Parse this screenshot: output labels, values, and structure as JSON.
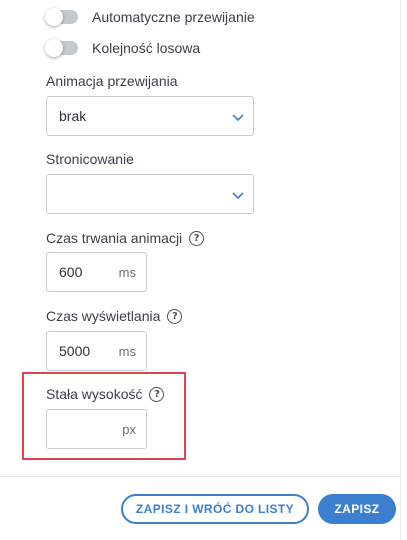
{
  "toggles": [
    {
      "label": "Automatyczne przewijanie",
      "on": false
    },
    {
      "label": "Kolejność losowa",
      "on": false
    }
  ],
  "animation": {
    "label": "Animacja przewijania",
    "value": "brak"
  },
  "pagination": {
    "label": "Stronicowanie",
    "value": ""
  },
  "animation_duration": {
    "label": "Czas trwania animacji",
    "value": "600",
    "unit": "ms"
  },
  "display_time": {
    "label": "Czas wyświetlania",
    "value": "5000",
    "unit": "ms"
  },
  "fixed_height": {
    "label": "Stała wysokość",
    "value": "",
    "unit": "px"
  },
  "buttons": {
    "save_and_back": "ZAPISZ I WRÓĆ DO LISTY",
    "save": "ZAPISZ"
  },
  "help_glyph": "?",
  "colors": {
    "accent": "#3d7fcf",
    "highlight": "#e0434a",
    "toggle_off": "#c4c8d0"
  }
}
